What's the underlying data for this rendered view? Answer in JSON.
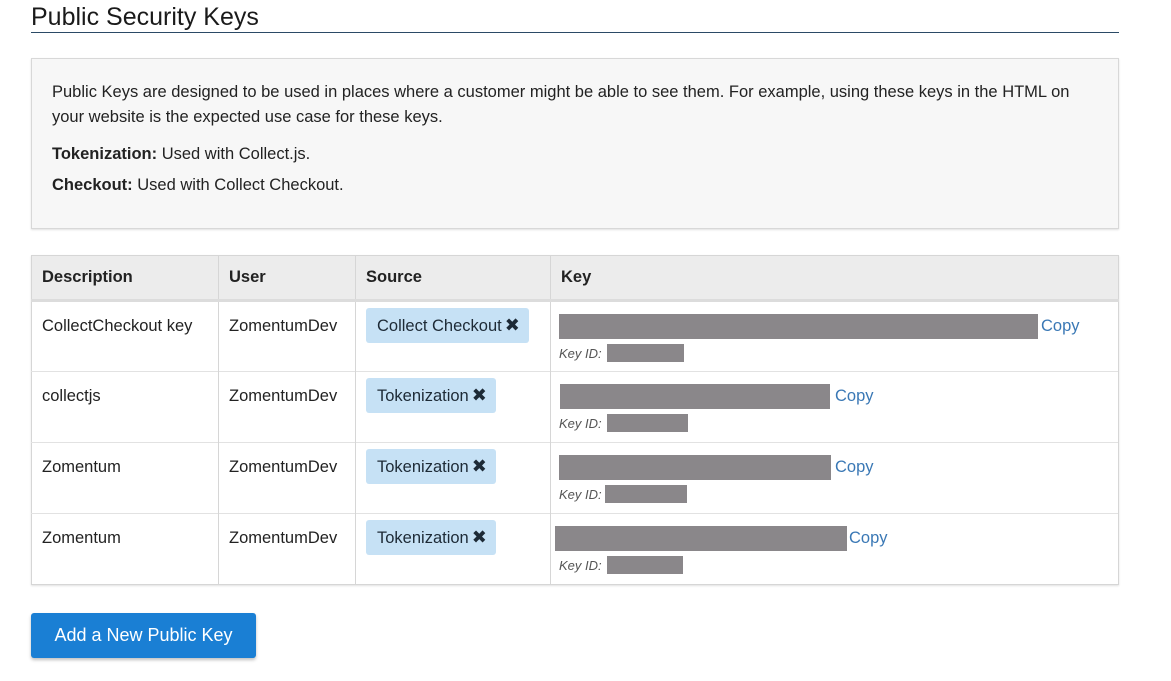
{
  "page": {
    "title": "Public Security Keys"
  },
  "info": {
    "description": "Public Keys are designed to be used in places where a customer might be able to see them. For example, using these keys in the HTML on your website is the expected use case for these keys.",
    "tokenization_term": "Tokenization:",
    "tokenization_text": " Used with Collect.js.",
    "checkout_term": "Checkout:",
    "checkout_text": " Used with Collect Checkout."
  },
  "table": {
    "headers": {
      "description": "Description",
      "user": "User",
      "source": "Source",
      "key": "Key"
    },
    "copy_label": "Copy",
    "key_id_label": "Key ID:",
    "remove_icon": "x-icon",
    "rows": [
      {
        "description": "CollectCheckout key",
        "user": "ZomentumDev",
        "source": "Collect Checkout"
      },
      {
        "description": "collectjs",
        "user": "ZomentumDev",
        "source": "Tokenization"
      },
      {
        "description": "Zomentum",
        "user": "ZomentumDev",
        "source": "Tokenization"
      },
      {
        "description": "Zomentum",
        "user": "ZomentumDev",
        "source": "Tokenization"
      }
    ]
  },
  "actions": {
    "add_label": "Add a New Public Key"
  },
  "colors": {
    "primary_button": "#1a7fd4",
    "badge_bg": "#c6e1f5",
    "link": "#3a78b5",
    "redaction": "#8a878a"
  }
}
